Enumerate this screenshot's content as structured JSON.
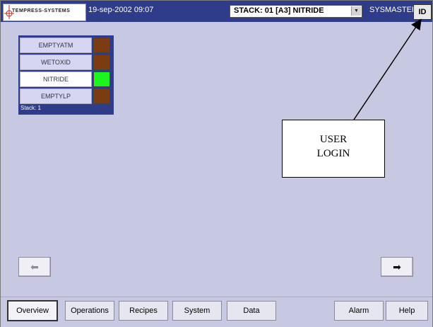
{
  "header": {
    "logo_text": "TEMPRESS-SYSTEMS",
    "datetime": "19-sep-2002 09:07",
    "stack_select": "STACK: 01 [A3] NITRIDE",
    "user": "SYSMASTER",
    "login_button": "ID"
  },
  "stack": {
    "label": "Stack: 1",
    "slots": [
      {
        "name": "EMPTYATM",
        "status_color": "#7a3c10"
      },
      {
        "name": "WETOXID",
        "status_color": "#7a3c10"
      },
      {
        "name": "NITRIDE",
        "status_color": "#1ef51e",
        "selected": true
      },
      {
        "name": "EMPTYLP",
        "status_color": "#7a3c10"
      }
    ]
  },
  "callout": {
    "line1": "USER",
    "line2": "LOGIN"
  },
  "navigation": {
    "prev_icon": "arrow-left-icon",
    "next_icon": "arrow-right-icon"
  },
  "tabs": [
    "Overview",
    "Operations",
    "Recipes",
    "System",
    "Data",
    "Alarm",
    "Help"
  ],
  "active_tab": "Overview",
  "colors": {
    "header_bg": "#2f3c8a",
    "screen_bg": "#c7c8e2",
    "active_status": "#1ef51e",
    "idle_status": "#7a3c10"
  }
}
